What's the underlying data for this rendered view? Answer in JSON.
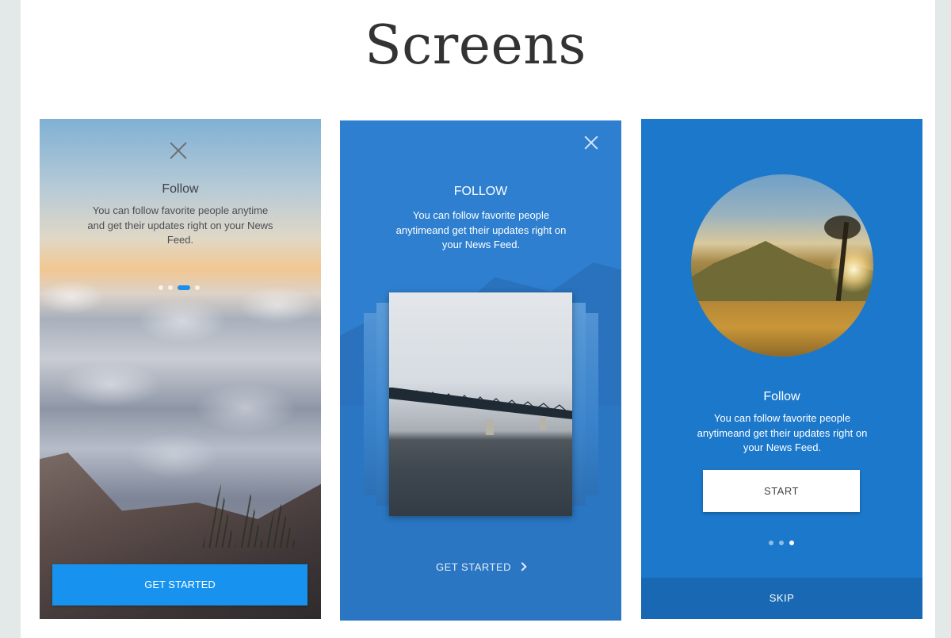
{
  "page": {
    "heading": "Screens"
  },
  "screen1": {
    "title": "Follow",
    "body": "You can follow favorite people anytime and get their updates right on your News Feed.",
    "cta": "GET STARTED",
    "pager": {
      "count": 4,
      "active_index": 2
    }
  },
  "screen2": {
    "title": "FOLLOW",
    "body": "You can follow favorite people anytimeand get their updates right on your News Feed.",
    "cta": "GET STARTED"
  },
  "screen3": {
    "title": "Follow",
    "body": "You can follow favorite people anytimeand get their updates right on your News Feed.",
    "start": "START",
    "skip": "SKIP",
    "pager": {
      "count": 3,
      "active_index": 2
    }
  },
  "colors": {
    "primary_blue": "#1793ef",
    "screen2_bg": "#2e7fcf",
    "screen3_bg": "#1c78cb",
    "skip_bar": "#1868b3"
  }
}
